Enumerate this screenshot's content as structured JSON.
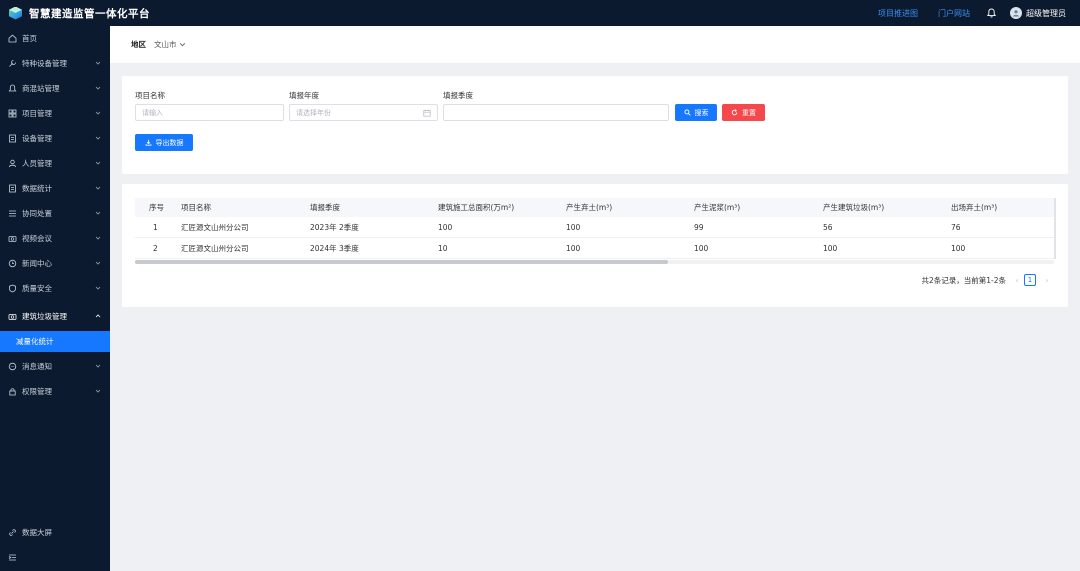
{
  "app": {
    "title": "智慧建造监管一体化平台"
  },
  "topbar": {
    "links": [
      "项目推进图",
      "门户网站"
    ],
    "user": "超级管理员",
    "accent": "#1677ff"
  },
  "sidebar": {
    "items": [
      {
        "label": "首页",
        "icon": "home-icon"
      },
      {
        "label": "特种设备管理",
        "icon": "wrench-icon"
      },
      {
        "label": "商混站管理",
        "icon": "bell-icon"
      },
      {
        "label": "项目管理",
        "icon": "grid-icon"
      },
      {
        "label": "设备管理",
        "icon": "doc-icon"
      },
      {
        "label": "人员管理",
        "icon": "user-icon"
      },
      {
        "label": "数据统计",
        "icon": "doc-icon"
      },
      {
        "label": "协同处置",
        "icon": "list-icon"
      },
      {
        "label": "视频会议",
        "icon": "camera-icon"
      },
      {
        "label": "新闻中心",
        "icon": "clock-icon"
      },
      {
        "label": "质量安全",
        "icon": "shield-icon"
      },
      {
        "label": "建筑垃圾管理",
        "icon": "camera-icon"
      },
      {
        "label": "消息通知",
        "icon": "message-icon"
      },
      {
        "label": "权限管理",
        "icon": "lock-icon"
      }
    ],
    "active_sub": "减量化统计",
    "footer": {
      "screen": "数据大屏"
    }
  },
  "region": {
    "label": "地区",
    "value": "文山市"
  },
  "filters": {
    "project_name_label": "项目名称",
    "project_name_placeholder": "请输入",
    "year_label": "填报年度",
    "year_placeholder": "请选择年份",
    "quarter_label": "填报季度",
    "search_btn": "搜索",
    "reset_btn": "重置",
    "export_btn": "导出数据"
  },
  "table": {
    "columns": [
      "序号",
      "项目名称",
      "填报季度",
      "建筑施工总面积(万m²)",
      "产生弃土(m³)",
      "产生泥浆(m³)",
      "产生建筑垃圾(m³)",
      "出场弃土(m³)"
    ],
    "rows": [
      [
        "1",
        "汇匠源文山州分公司",
        "2023年 2季度",
        "100",
        "100",
        "99",
        "56",
        "76"
      ],
      [
        "2",
        "汇匠源文山州分公司",
        "2024年 3季度",
        "10",
        "100",
        "100",
        "100",
        "100"
      ]
    ]
  },
  "pager": {
    "summary": "共2条记录，当前第1-2条",
    "current": "1"
  }
}
